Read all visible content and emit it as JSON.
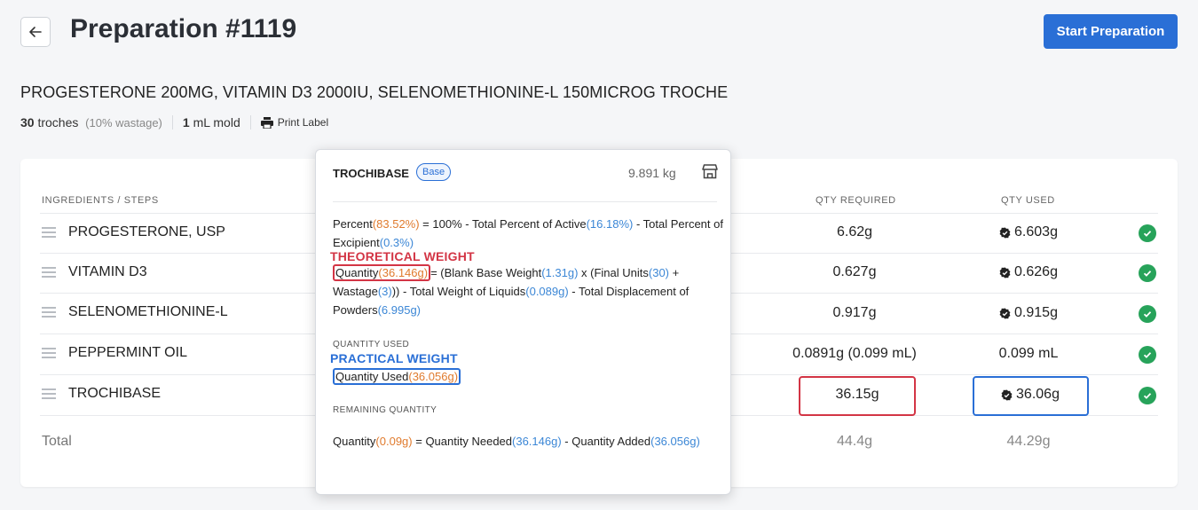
{
  "header": {
    "title": "Preparation #1119",
    "start_label": "Start Preparation"
  },
  "product": {
    "name": "PROGESTERONE 200MG, VITAMIN D3 2000IU, SELENOMETHIONINE-L 150MICROG TROCHE",
    "count": "30",
    "unit": "troches",
    "wastage": "(10% wastage)",
    "mold_value": "1",
    "mold_unit": "mL mold",
    "print_label": "Print Label"
  },
  "table": {
    "col_ingredients": "INGREDIENTS / STEPS",
    "col_qty_required": "QTY REQUIRED",
    "col_qty_used": "QTY USED",
    "rows": [
      {
        "name": "PROGESTERONE, USP",
        "required": "6.62g",
        "used": "6.603g",
        "verified": true
      },
      {
        "name": "VITAMIN D3",
        "required": "0.627g",
        "used": "0.626g",
        "verified": true
      },
      {
        "name": "SELENOMETHIONINE-L",
        "required": "0.917g",
        "used": "0.915g",
        "verified": true
      },
      {
        "name": "PEPPERMINT OIL",
        "required": "0.0891g (0.099 mL)",
        "used": "0.099 mL",
        "verified": false
      },
      {
        "name": "TROCHIBASE",
        "required": "36.15g",
        "used": "36.06g",
        "verified": true
      }
    ],
    "total_label": "Total",
    "total_required": "44.4g",
    "total_used": "44.29g"
  },
  "popover": {
    "title": "TROCHIBASE",
    "badge": "Base",
    "stock": "9.891 kg",
    "percent_label": "Percent",
    "percent_value": "(83.52%)",
    "percent_mid": " = 100% - Total Percent of Active",
    "active_value": "(16.18%)",
    "percent_tail": " - Total Percent of Excipient",
    "excipient_value": "(0.3%)",
    "theoretical_annotation": "THEORETICAL WEIGHT",
    "qty_label": "Quantity",
    "qty_value": "(36.146g)",
    "qty_mid": "= (Blank Base Weight",
    "blank_value": "(1.31g)",
    "qty_mid2": " x (Final Units",
    "units_value": "(30)",
    "qty_mid3": " + Wastage",
    "wastage_value": "(3)",
    "qty_mid4": ")) - Total Weight of Liquids",
    "liquids_value": "(0.089g)",
    "qty_mid5": " - Total Displacement of Powders",
    "powders_value": "(6.995g)",
    "qty_used_section": "QUANTITY USED",
    "practical_annotation": "PRACTICAL WEIGHT",
    "qty_used_label": "Quantity Used",
    "qty_used_value": "(36.056g)",
    "remaining_section": "REMAINING QUANTITY",
    "rem_label": "Quantity",
    "rem_value": "(0.09g)",
    "rem_mid": " = Quantity Needed",
    "rem_needed": "(36.146g)",
    "rem_mid2": " - Quantity Added",
    "rem_added": "(36.056g)"
  },
  "colors": {
    "primary": "#2a6fd6",
    "success": "#27a35a",
    "orange": "#e07b2e",
    "highlight_red": "#d33545"
  }
}
